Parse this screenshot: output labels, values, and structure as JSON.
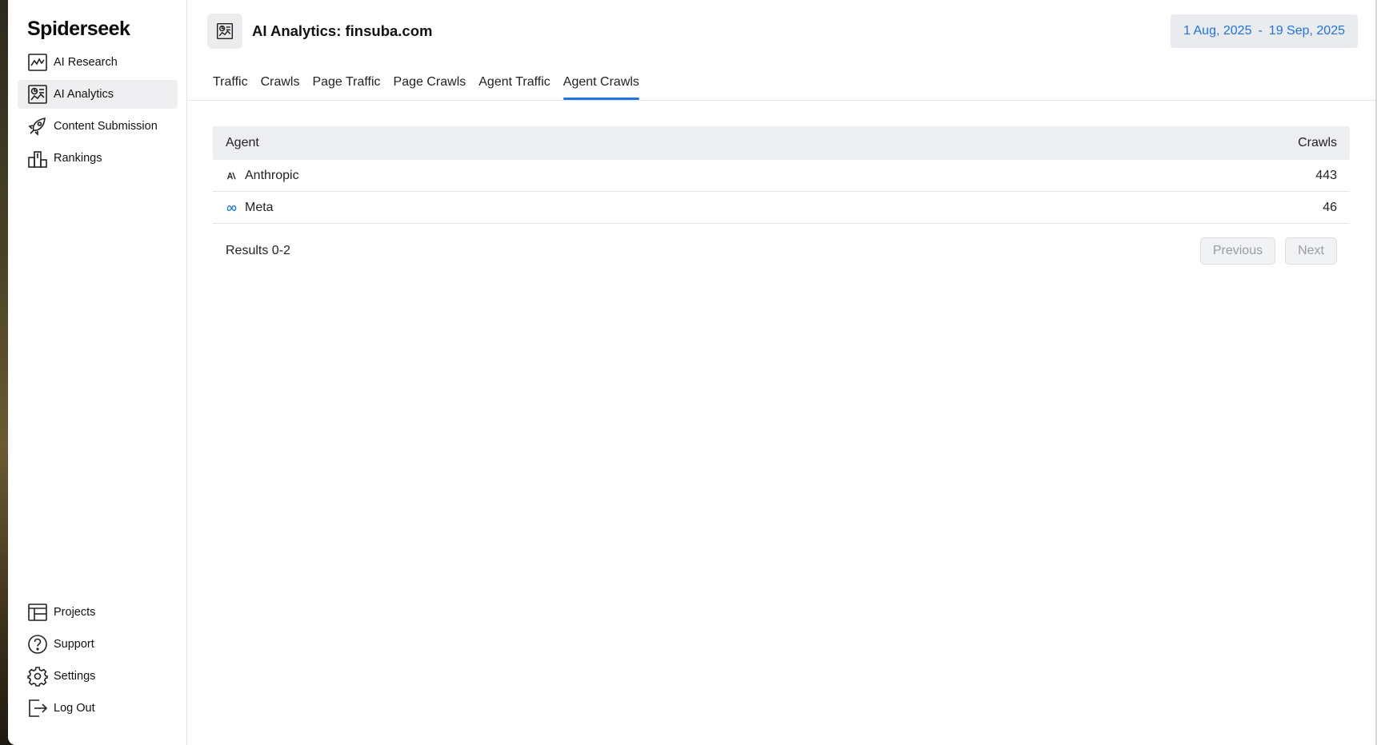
{
  "app": {
    "name": "Spiderseek"
  },
  "sidebar": {
    "top_items": [
      {
        "label": "AI Research",
        "icon": "chart-line-icon"
      },
      {
        "label": "AI Analytics",
        "icon": "analytics-icon",
        "active": true
      },
      {
        "label": "Content Submission",
        "icon": "rocket-icon"
      },
      {
        "label": "Rankings",
        "icon": "podium-icon"
      }
    ],
    "bottom_items": [
      {
        "label": "Projects",
        "icon": "table-icon"
      },
      {
        "label": "Support",
        "icon": "help-icon"
      },
      {
        "label": "Settings",
        "icon": "gear-icon"
      },
      {
        "label": "Log Out",
        "icon": "logout-icon"
      }
    ]
  },
  "header": {
    "title": "AI Analytics: finsuba.com",
    "date_start": "1 Aug, 2025",
    "date_sep": "-",
    "date_end": "19 Sep, 2025"
  },
  "tabs": [
    {
      "label": "Traffic"
    },
    {
      "label": "Crawls"
    },
    {
      "label": "Page Traffic"
    },
    {
      "label": "Page Crawls"
    },
    {
      "label": "Agent Traffic"
    },
    {
      "label": "Agent Crawls",
      "active": true
    }
  ],
  "table": {
    "columns": [
      "Agent",
      "Crawls"
    ],
    "rows": [
      {
        "agent": "Anthropic",
        "logo": "anthropic-logo-icon",
        "crawls": "443"
      },
      {
        "agent": "Meta",
        "logo": "meta-logo-icon",
        "crawls": "46"
      }
    ]
  },
  "pagination": {
    "results": "Results 0-2",
    "previous": "Previous",
    "next": "Next"
  },
  "colors": {
    "accent": "#1f73e6",
    "active_nav_bg": "#efeff1",
    "table_header_bg": "#eceef1"
  }
}
